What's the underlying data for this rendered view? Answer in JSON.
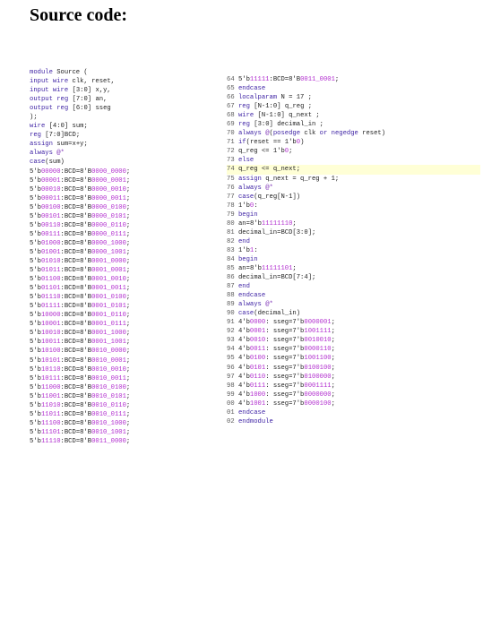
{
  "heading": "Source code:",
  "left_lines": [
    "module Source (",
    "input wire clk, reset,",
    "input wire [3:0] x,y,",
    "output reg [7:0] an,",
    "output reg [6:0] sseg",
    ");",
    "wire [4:0] sum;",
    "reg [7:0]BCD;",
    "assign sum=x+y;",
    "always @*",
    "case(sum)",
    "5'b00000:BCD=8'B0000_0000;",
    "5'b00001:BCD=8'B0000_0001;",
    "5'b00010:BCD=8'B0000_0010;",
    "5'b00011:BCD=8'B0000_0011;",
    "5'b00100:BCD=8'B0000_0100;",
    "5'b00101:BCD=8'B0000_0101;",
    "5'b00110:BCD=8'B0000_0110;",
    "5'b00111:BCD=8'B0000_0111;",
    "5'b01000:BCD=8'B0000_1000;",
    "5'b01001:BCD=8'B0000_1001;",
    "5'b01010:BCD=8'B0001_0000;",
    "5'b01011:BCD=8'B0001_0001;",
    "5'b01100:BCD=8'B0001_0010;",
    "5'b01101:BCD=8'B0001_0011;",
    "5'b01110:BCD=8'B0001_0100;",
    "5'b01111:BCD=8'B0001_0101;",
    "5'b10000:BCD=8'B0001_0110;",
    "5'b10001:BCD=8'B0001_0111;",
    "5'b10010:BCD=8'B0001_1000;",
    "5'b10011:BCD=8'B0001_1001;",
    "5'b10100:BCD=8'B0010_0000;",
    "5'b10101:BCD=8'B0010_0001;",
    "5'b10110:BCD=8'B0010_0010;",
    "5'b10111:BCD=8'B0010_0011;",
    "5'b11000:BCD=8'B0010_0100;",
    "5'b11001:BCD=8'B0010_0101;",
    "5'b11010:BCD=8'B0010_0110;",
    "5'b11011:BCD=8'B0010_0111;",
    "5'b11100:BCD=8'B0010_1000;",
    "5'b11101:BCD=8'B0010_1001;",
    "5'b11110:BCD=8'B0011_0000;"
  ],
  "right_lines": [
    {
      "num": "64",
      "text": "5'b11111:BCD=8'B0011_0001;"
    },
    {
      "num": "65",
      "text": "endcase"
    },
    {
      "num": "66",
      "text": "localparam N = 17 ;"
    },
    {
      "num": "67",
      "text": "reg [N-1:0] q_reg ;"
    },
    {
      "num": "68",
      "text": "wire [N-1:0] q_next ;"
    },
    {
      "num": "69",
      "text": "reg [3:0] decimal_in ;"
    },
    {
      "num": "70",
      "text": "always @(posedge clk or negedge reset)"
    },
    {
      "num": "71",
      "text": "if(reset == 1'b0)"
    },
    {
      "num": "72",
      "text": "q_reg <= 1'b0;"
    },
    {
      "num": "73",
      "text": "else"
    },
    {
      "num": "74",
      "text": "q_reg <= q_next;",
      "highlight": true
    },
    {
      "num": "75",
      "text": "assign q_next = q_reg + 1;"
    },
    {
      "num": "76",
      "text": "always @*"
    },
    {
      "num": "77",
      "text": "case(q_reg[N-1])"
    },
    {
      "num": "78",
      "text": "1'b0:"
    },
    {
      "num": "79",
      "text": "begin"
    },
    {
      "num": "80",
      "text": "an=8'b11111110;"
    },
    {
      "num": "81",
      "text": "decimal_in=BCD[3:0];"
    },
    {
      "num": "82",
      "text": "end"
    },
    {
      "num": "83",
      "text": "1'b1:"
    },
    {
      "num": "84",
      "text": "begin"
    },
    {
      "num": "85",
      "text": "an=8'b11111101;"
    },
    {
      "num": "86",
      "text": "decimal_in=BCD[7:4];"
    },
    {
      "num": "87",
      "text": "end"
    },
    {
      "num": "88",
      "text": "endcase"
    },
    {
      "num": "89",
      "text": "always @*"
    },
    {
      "num": "90",
      "text": "case(decimal_in)"
    },
    {
      "num": "91",
      "text": "4'b0000: sseg=7'b0000001;"
    },
    {
      "num": "92",
      "text": "4'b0001: sseg=7'b1001111;"
    },
    {
      "num": "93",
      "text": "4'b0010: sseg=7'b0010010;"
    },
    {
      "num": "94",
      "text": "4'b0011: sseg=7'b0000110;"
    },
    {
      "num": "95",
      "text": "4'b0100: sseg=7'b1001100;"
    },
    {
      "num": "96",
      "text": "4'b0101: sseg=7'b0100100;"
    },
    {
      "num": "97",
      "text": "4'b0110: sseg=7'b0100000;"
    },
    {
      "num": "98",
      "text": "4'b0111: sseg=7'b0001111;"
    },
    {
      "num": "99",
      "text": "4'b1000: sseg=7'b0000000;"
    },
    {
      "num": "00",
      "text": "4'b1001: sseg=7'b0000100;"
    },
    {
      "num": "01",
      "text": "endcase"
    },
    {
      "num": "02",
      "text": "endmodule"
    }
  ]
}
